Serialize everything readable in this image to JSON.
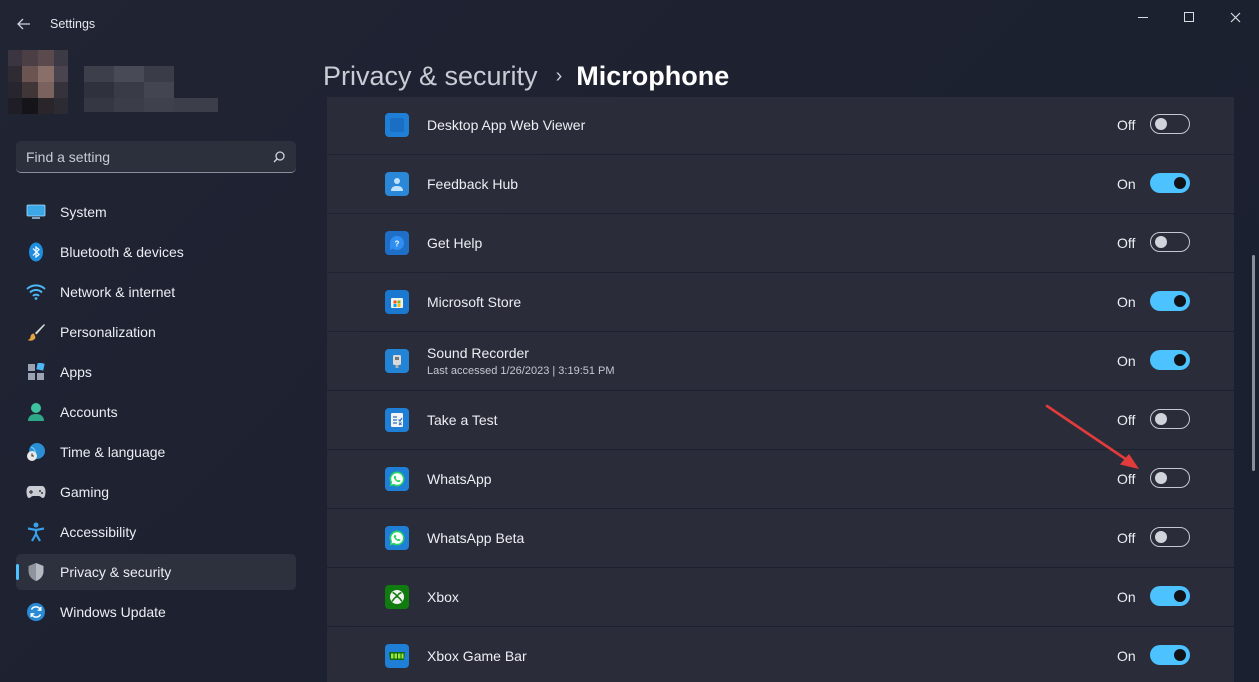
{
  "window": {
    "title": "Settings",
    "colors": {
      "accent": "#4cc2ff",
      "row_bg": "#2a2d39",
      "annotation": "#e23b3b"
    }
  },
  "search": {
    "placeholder": "Find a setting"
  },
  "nav": {
    "items": [
      {
        "id": "system",
        "label": "System",
        "icon": "monitor-icon",
        "active": false
      },
      {
        "id": "bluetooth",
        "label": "Bluetooth & devices",
        "icon": "bluetooth-icon",
        "active": false
      },
      {
        "id": "network",
        "label": "Network & internet",
        "icon": "wifi-icon",
        "active": false
      },
      {
        "id": "personalization",
        "label": "Personalization",
        "icon": "brush-icon",
        "active": false
      },
      {
        "id": "apps",
        "label": "Apps",
        "icon": "apps-icon",
        "active": false
      },
      {
        "id": "accounts",
        "label": "Accounts",
        "icon": "person-icon",
        "active": false
      },
      {
        "id": "time",
        "label": "Time & language",
        "icon": "globe-clock-icon",
        "active": false
      },
      {
        "id": "gaming",
        "label": "Gaming",
        "icon": "gamepad-icon",
        "active": false
      },
      {
        "id": "accessibility",
        "label": "Accessibility",
        "icon": "accessibility-icon",
        "active": false
      },
      {
        "id": "privacy",
        "label": "Privacy & security",
        "icon": "shield-icon",
        "active": true
      },
      {
        "id": "update",
        "label": "Windows Update",
        "icon": "update-icon",
        "active": false
      }
    ]
  },
  "header": {
    "parent": "Privacy & security",
    "separator": "›",
    "current": "Microphone"
  },
  "apps": [
    {
      "name": "Desktop App Web Viewer",
      "subtitle": "",
      "state": "Off",
      "on": false,
      "icon": "web-viewer-icon"
    },
    {
      "name": "Feedback Hub",
      "subtitle": "",
      "state": "On",
      "on": true,
      "icon": "feedback-hub-icon"
    },
    {
      "name": "Get Help",
      "subtitle": "",
      "state": "Off",
      "on": false,
      "icon": "get-help-icon"
    },
    {
      "name": "Microsoft Store",
      "subtitle": "",
      "state": "On",
      "on": true,
      "icon": "store-icon"
    },
    {
      "name": "Sound Recorder",
      "subtitle": "Last accessed 1/26/2023  |  3:19:51 PM",
      "state": "On",
      "on": true,
      "icon": "sound-recorder-icon"
    },
    {
      "name": "Take a Test",
      "subtitle": "",
      "state": "Off",
      "on": false,
      "icon": "take-a-test-icon"
    },
    {
      "name": "WhatsApp",
      "subtitle": "",
      "state": "Off",
      "on": false,
      "icon": "whatsapp-icon"
    },
    {
      "name": "WhatsApp Beta",
      "subtitle": "",
      "state": "Off",
      "on": false,
      "icon": "whatsapp-icon"
    },
    {
      "name": "Xbox",
      "subtitle": "",
      "state": "On",
      "on": true,
      "icon": "xbox-icon"
    },
    {
      "name": "Xbox Game Bar",
      "subtitle": "",
      "state": "On",
      "on": true,
      "icon": "xbox-game-bar-icon"
    }
  ]
}
